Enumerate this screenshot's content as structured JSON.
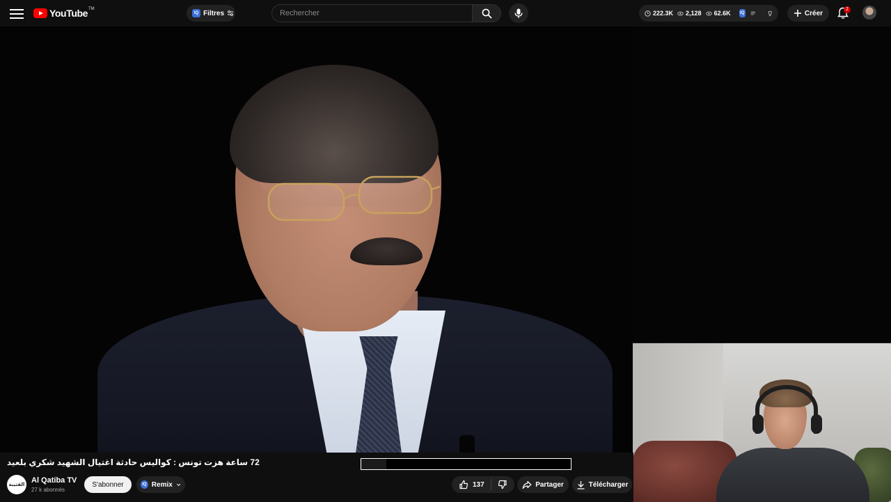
{
  "header": {
    "logo_text": "YouTube",
    "logo_tm": "TM",
    "filters_badge": "IQ",
    "filters_label": "Filtres",
    "search_placeholder": "Rechercher",
    "stats": [
      {
        "icon": "clock-icon",
        "value": "222.3K"
      },
      {
        "icon": "eye-icon",
        "value": "2,128"
      },
      {
        "icon": "eye-icon",
        "value": "62.6K"
      }
    ],
    "stats_badge": "IQ",
    "create_label": "Créer",
    "notification_count": "2"
  },
  "video": {
    "title": "72 ساعة هزت تونس : كواليس حادثة اغتيال الشهيد شكري بلعيد",
    "progress": 0.12
  },
  "channel": {
    "avatar_text": "القتيبة",
    "name": "Al Qatiba TV",
    "subscribers": "27 k abonnés",
    "subscribe_label": "S'abonner",
    "remix_badge": "IQ",
    "remix_label": "Remix"
  },
  "actions": {
    "like_count": "137",
    "share_label": "Partager",
    "download_label": "Télécharger"
  },
  "colors": {
    "background": "#0f0f0f",
    "brand_red": "#ff0000",
    "badge_blue": "#3b6fd8",
    "notification_red": "#cc0000"
  }
}
